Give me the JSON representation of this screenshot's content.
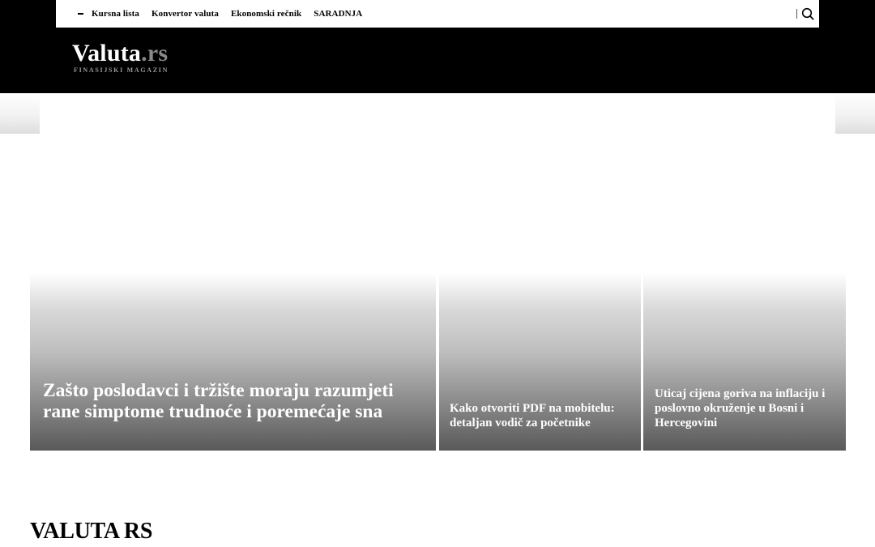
{
  "topbar": {
    "menu": [
      {
        "label": "Kursna lista"
      },
      {
        "label": "Konvertor valuta"
      },
      {
        "label": "Ekonomski rečnik"
      },
      {
        "label": "SARADNJA"
      }
    ],
    "search_icon": "search-icon"
  },
  "logo": {
    "name": "Valuta",
    "suffix": ".rs",
    "tagline": "FINASIJSKI MAGAZIN"
  },
  "featured": [
    {
      "title": "Zašto poslodavci i tržište moraju razumjeti rane simptome trudnoće i poremećaje sna"
    },
    {
      "title": "Kako otvoriti PDF na mobitelu: detaljan vodič za početnike"
    },
    {
      "title": "Uticaj cijena goriva na inflaciju i poslovno okruženje u Bosni i Hercegovini"
    }
  ],
  "section": {
    "title": "VALUTA RS"
  },
  "colors": {
    "header_bg": "#000000",
    "logo_suffix": "#8a8a8a",
    "card_text": "#ffffff"
  }
}
